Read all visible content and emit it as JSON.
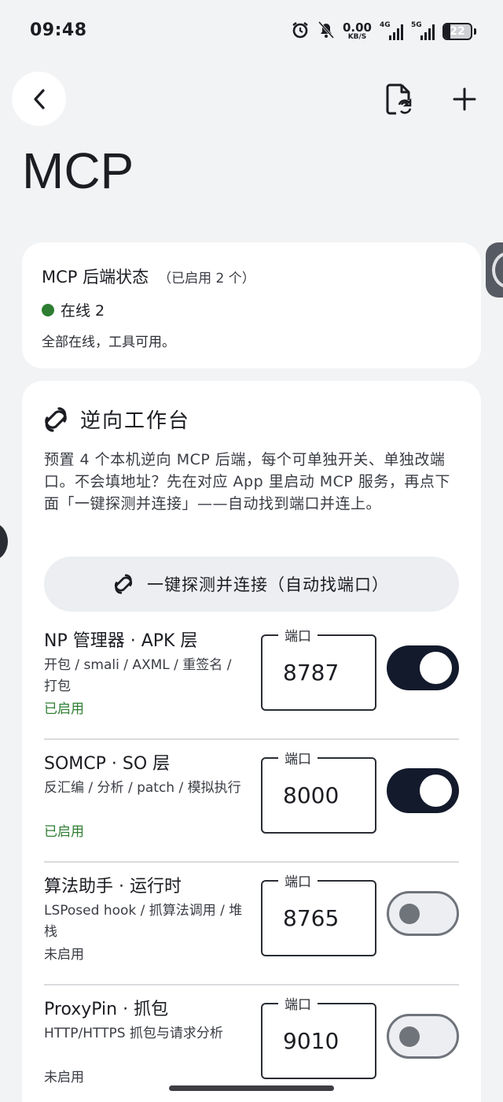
{
  "status_bar": {
    "time": "09:48",
    "net_speed_value": "0.00",
    "net_speed_unit": "KB/S",
    "signal1_label": "4G",
    "signal2_label": "5G",
    "battery": "22",
    "icons": [
      "alarm-icon",
      "bell-off-icon"
    ]
  },
  "header": {
    "title": "MCP",
    "back_icon": "chevron-left-icon",
    "action_icons": [
      "file-sync-icon",
      "plus-icon"
    ]
  },
  "status_card": {
    "title": "MCP 后端状态",
    "enabled_count": "（已启用 2 个）",
    "online_label": "在线 2",
    "online_color": "#2e7d32",
    "description": "全部在线，工具可用。"
  },
  "workbench": {
    "title": "逆向工作台",
    "icon": "link-icon",
    "description": "预置 4 个本机逆向 MCP 后端，每个可单独开关、单独改端口。不会填地址？先在对应 App 里启动 MCP 服务，再点下面「一键探测并连接」——自动找到端口并连上。",
    "detect_button": "一键探测并连接（自动找端口）",
    "port_label": "端口",
    "backends": [
      {
        "name": "NP 管理器 · APK 层",
        "desc": "开包 / smali / AXML / 重签名 / 打包",
        "status": "已启用",
        "port": "8787",
        "enabled": true
      },
      {
        "name": "SOMCP · SO 层",
        "desc": "反汇编 / 分析 / patch / 模拟执行",
        "status": "已启用",
        "port": "8000",
        "enabled": true
      },
      {
        "name": "算法助手 · 运行时",
        "desc": "LSPosed hook / 抓算法调用 / 堆栈",
        "status": "未启用",
        "port": "8765",
        "enabled": false
      },
      {
        "name": "ProxyPin · 抓包",
        "desc": "HTTP/HTTPS 抓包与请求分析",
        "status": "未启用",
        "port": "9010",
        "enabled": false
      }
    ]
  },
  "colors": {
    "background": "#f2f3f5",
    "card": "#ffffff",
    "toggle_on": "#131a2c",
    "enabled_text": "#2e7d32"
  }
}
